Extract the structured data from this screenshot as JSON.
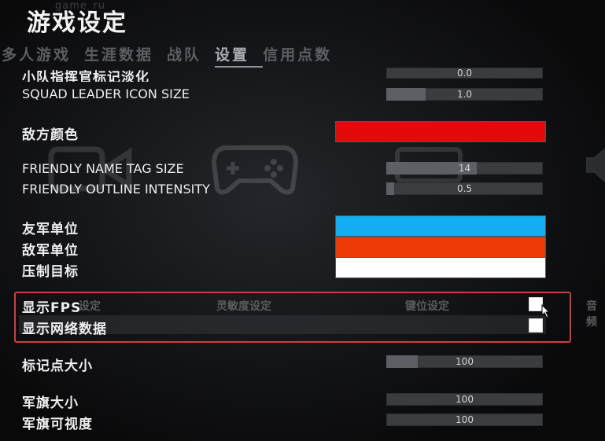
{
  "watermark": "game_ru",
  "title": "游戏设定",
  "tabs": [
    "多人游戏",
    "生涯数据",
    "战队",
    "设置",
    "信用点数"
  ],
  "active_tab": "设置",
  "settings": {
    "squad_marker_fade": {
      "label": "小队指挥官标记淡化",
      "value": "0.0",
      "fill": 0.0
    },
    "squad_leader_icon_size": {
      "label": "SQUAD LEADER ICON SIZE",
      "value": "1.0",
      "fill": 0.25
    },
    "enemy_color": {
      "label": "敌方颜色",
      "color": "#e50a0a"
    },
    "friendly_name_tag_size": {
      "label": "FRIENDLY NAME TAG SIZE",
      "value": "14",
      "fill": 0.58
    },
    "friendly_outline_intensity": {
      "label": "FRIENDLY OUTLINE INTENSITY",
      "value": "0.5",
      "fill": 0.05
    },
    "friendly_unit": {
      "label": "友军单位",
      "color": "#13aef2"
    },
    "enemy_unit": {
      "label": "敌军单位",
      "color": "#ee3a07"
    },
    "suppression_target": {
      "label": "压制目标",
      "color": "#ffffff"
    },
    "show_fps": {
      "label": "显示FPS",
      "checked": false
    },
    "show_network": {
      "label": "显示网络数据",
      "checked": false
    },
    "marker_size": {
      "label": "标记点大小",
      "value": "100",
      "fill": 0.2
    },
    "flag_size": {
      "label": "军旗大小",
      "value": "100",
      "fill": 0.0
    },
    "flag_visibility": {
      "label": "军旗可视度",
      "value": "100",
      "fill": 0.0
    }
  },
  "background_labels": [
    "设定",
    "灵敏度设定",
    "键位设定",
    "音频"
  ],
  "icons": [
    "camera-icon",
    "gamepad-icon",
    "keyboard-icon",
    "speaker-icon"
  ]
}
